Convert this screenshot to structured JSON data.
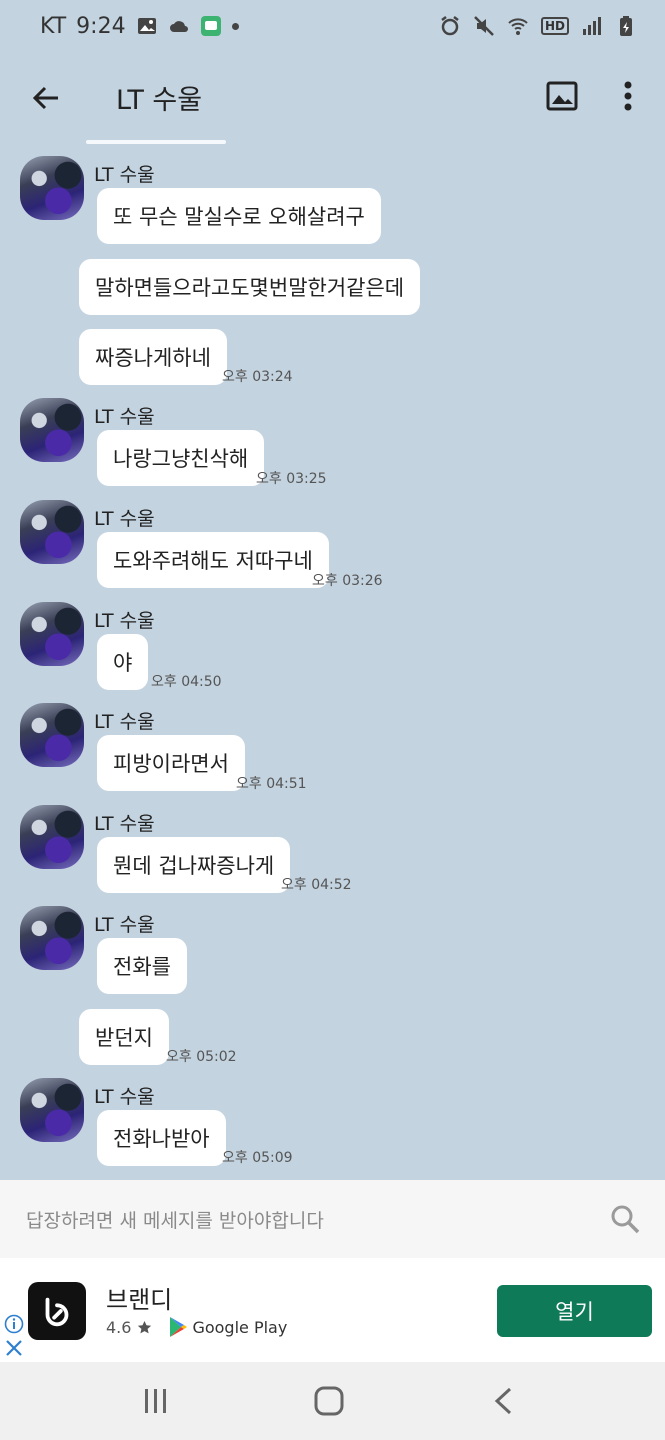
{
  "status_bar": {
    "carrier": "KT",
    "time": "9:24",
    "hd_label": "HD"
  },
  "header": {
    "title": "LT 수울"
  },
  "messages": [
    {
      "sender": "LT 수울",
      "text": "또 무슨 말실수로 오해살려구",
      "time": ""
    },
    {
      "sender": "",
      "text": "말하면들으라고도몇번말한거같은데",
      "time": ""
    },
    {
      "sender": "",
      "text": "짜증나게하네",
      "time": "오후 03:24"
    },
    {
      "sender": "LT 수울",
      "text": "나랑그냥친삭해",
      "time": "오후 03:25"
    },
    {
      "sender": "LT 수울",
      "text": "도와주려해도 저따구네",
      "time": "오후 03:26"
    },
    {
      "sender": "LT 수울",
      "text": "야",
      "time": "오후 04:50"
    },
    {
      "sender": "LT 수울",
      "text": "피방이라면서",
      "time": "오후 04:51"
    },
    {
      "sender": "LT 수울",
      "text": "뭔데 겁나짜증나게",
      "time": "오후 04:52"
    },
    {
      "sender": "LT 수울",
      "text": "전화를",
      "time": ""
    },
    {
      "sender": "",
      "text": "받던지",
      "time": "오후 05:02"
    },
    {
      "sender": "LT 수울",
      "text": "전화나받아",
      "time": "오후 05:09"
    }
  ],
  "reply_bar": {
    "placeholder": "답장하려면 새 메세지를 받아야합니다"
  },
  "ad": {
    "app_name": "브랜디",
    "rating": "4.6",
    "store": "Google Play",
    "open_label": "열기"
  },
  "colors": {
    "chat_background": "#c3d3e0",
    "bubble": "#ffffff",
    "ad_button": "#0f7a57"
  }
}
